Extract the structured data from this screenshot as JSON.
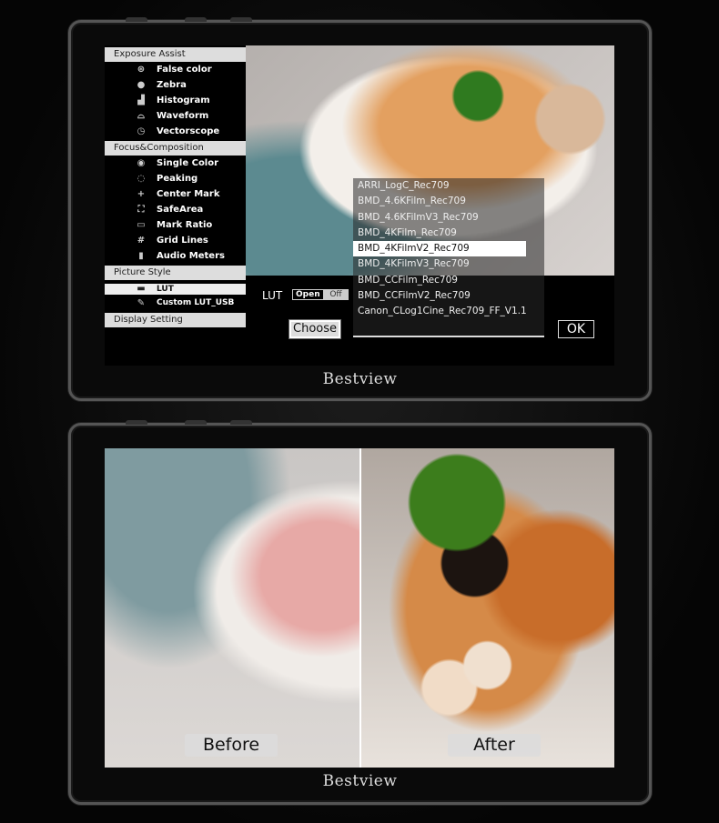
{
  "brand": "Bestview",
  "menu": {
    "sections": [
      {
        "title": "Exposure Assist",
        "items": [
          {
            "label": "False color",
            "icon": "false-color-icon"
          },
          {
            "label": "Zebra",
            "icon": "zebra-icon"
          },
          {
            "label": "Histogram",
            "icon": "histogram-icon"
          },
          {
            "label": "Waveform",
            "icon": "waveform-icon"
          },
          {
            "label": "Vectorscope",
            "icon": "vectorscope-icon"
          }
        ]
      },
      {
        "title": "Focus&Composition",
        "items": [
          {
            "label": "Single Color",
            "icon": "single-color-icon"
          },
          {
            "label": "Peaking",
            "icon": "peaking-icon"
          },
          {
            "label": "Center Mark",
            "icon": "plus-icon"
          },
          {
            "label": "SafeArea",
            "icon": "safe-area-icon"
          },
          {
            "label": "Mark Ratio",
            "icon": "mark-ratio-icon"
          },
          {
            "label": "Grid Lines",
            "icon": "grid-icon"
          },
          {
            "label": "Audio Meters",
            "icon": "audio-meter-icon"
          }
        ]
      },
      {
        "title": "Picture Style",
        "items": [
          {
            "label": "LUT",
            "icon": "lut-icon",
            "selected": true
          },
          {
            "label": "Custom LUT_USB",
            "icon": "edit-icon"
          }
        ]
      },
      {
        "title": "Display Setting",
        "items": []
      }
    ]
  },
  "lut": {
    "label": "LUT",
    "open": "Open",
    "off": "Off",
    "choose": "Choose",
    "ok": "OK",
    "list": [
      "ARRI_LogC_Rec709",
      "BMD_4.6KFilm_Rec709",
      "BMD_4.6KFilmV3_Rec709",
      "BMD_4KFilm_Rec709",
      "BMD_4KFilmV2_Rec709",
      "BMD_4KFilmV3_Rec709",
      "BMD_CCFilm_Rec709",
      "BMD_CCFilmV2_Rec709",
      "Canon_CLog1Cine_Rec709_FF_V1.1"
    ],
    "selected": "BMD_4KFilmV2_Rec709"
  },
  "compare": {
    "before": "Before",
    "after": "After"
  }
}
